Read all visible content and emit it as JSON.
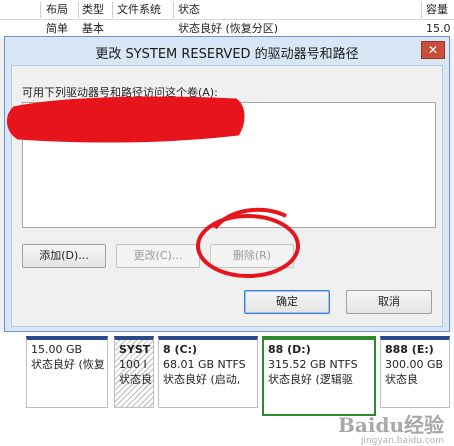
{
  "background_list": {
    "columns": [
      "布局",
      "类型",
      "文件系统",
      "状态",
      "容量"
    ],
    "row": {
      "layout": "简单",
      "type": "基本",
      "status": "状态良好 (恢复分区)",
      "capacity": "15.0"
    }
  },
  "disk_map": {
    "partitions": [
      {
        "name": "",
        "size": "15.00 GB",
        "status": "状态良好 (恢复"
      },
      {
        "name": "SYST",
        "size": "100 I",
        "status": "状态良"
      },
      {
        "name": "8  (C:)",
        "size": "68.01 GB NTFS",
        "status": "状态良好 (启动,"
      },
      {
        "name": "88  (D:)",
        "size": "315.52 GB NTFS",
        "status": "状态良好 (逻辑驱"
      },
      {
        "name": "888  (E:)",
        "size": "300.00 GB",
        "status": "状态良"
      }
    ],
    "watermark": "Baidu经验",
    "watermark_sub": "jingyan.baidu.com"
  },
  "dialog": {
    "title": "更改 SYSTEM RESERVED 的驱动器号和路径",
    "close_label": "✕",
    "instruction": "可用下列驱动器号和路径访问这个卷(A):",
    "buttons": {
      "add": "添加(D)...",
      "change": "更改(C)...",
      "remove": "删除(R)",
      "ok": "确定",
      "cancel": "取消"
    }
  },
  "colors": {
    "dialog_frame": "#d8e6f6",
    "close": "#c74f3c",
    "annotation": "#e8141c",
    "selected_partition": "#2d8a2d"
  }
}
